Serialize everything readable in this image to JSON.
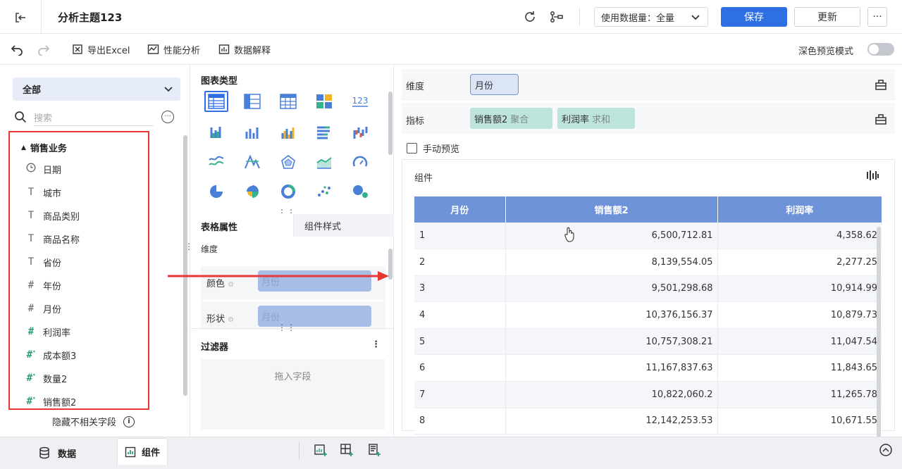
{
  "header": {
    "title": "分析主题123",
    "data_volume_label": "使用数据量：全量",
    "save_label": "保存",
    "update_label": "更新",
    "more_label": "···"
  },
  "toolbar": {
    "export_label": "导出Excel",
    "perf_label": "性能分析",
    "explain_label": "数据解释",
    "dark_mode_label": "深色预览模式"
  },
  "left": {
    "scope": "全部",
    "search_placeholder": "搜索",
    "group": "销售业务",
    "fields": [
      {
        "label": "日期",
        "type": "date",
        "icon": "clock-icon"
      },
      {
        "label": "城市",
        "type": "text",
        "icon": "text-icon"
      },
      {
        "label": "商品类别",
        "type": "text",
        "icon": "text-icon"
      },
      {
        "label": "商品名称",
        "type": "text",
        "icon": "text-icon"
      },
      {
        "label": "省份",
        "type": "text",
        "icon": "text-icon"
      },
      {
        "label": "年份",
        "type": "number",
        "icon": "hash-icon"
      },
      {
        "label": "月份",
        "type": "number",
        "icon": "hash-icon"
      },
      {
        "label": "利润率",
        "type": "measure",
        "icon": "hash-icon"
      },
      {
        "label": "成本额3",
        "type": "calc",
        "icon": "hash-calc-icon"
      },
      {
        "label": "数量2",
        "type": "calc",
        "icon": "hash-calc-icon"
      },
      {
        "label": "销售额2",
        "type": "calc",
        "icon": "hash-calc-icon"
      }
    ],
    "hide_irrelevant": "隐藏不相关字段"
  },
  "middle": {
    "chart_types_title": "图表类型",
    "chart_types_last_label": "123",
    "tab_table_props": "表格属性",
    "tab_component_style": "组件样式",
    "dimension_label": "维度",
    "color_label": "颜色",
    "color_value": "月份",
    "shape_label": "形状",
    "shape_value": "月份",
    "filter_title": "过滤器",
    "filter_placeholder": "拖入字段"
  },
  "right": {
    "dimension_label": "维度",
    "dimension_chip": "月份",
    "indicator_label": "指标",
    "indicator_chips": [
      {
        "name": "销售额2",
        "agg": "聚合"
      },
      {
        "name": "利润率",
        "agg": "求和"
      }
    ],
    "manual_preview": "手动预览",
    "component_title": "组件",
    "table": {
      "headers": [
        "月份",
        "销售额2",
        "利润率"
      ],
      "rows": [
        [
          "1",
          "6,500,712.81",
          "4,358.62"
        ],
        [
          "2",
          "8,139,554.05",
          "2,277.25"
        ],
        [
          "3",
          "9,501,298.68",
          "10,914.99"
        ],
        [
          "4",
          "10,376,156.37",
          "10,879.73"
        ],
        [
          "5",
          "10,757,308.21",
          "11,047.54"
        ],
        [
          "6",
          "11,167,837.63",
          "11,843.65"
        ],
        [
          "7",
          "10,822,060.2",
          "11,265.78"
        ],
        [
          "8",
          "12,142,253.53",
          "10,671.55"
        ]
      ]
    }
  },
  "bottom": {
    "data_tab": "数据",
    "component_tab": "组件"
  },
  "colors": {
    "primary": "#2f6fe4",
    "table_header": "#6f93d9",
    "highlight_red": "#e53935",
    "indicator_chip": "#bde4dc"
  }
}
